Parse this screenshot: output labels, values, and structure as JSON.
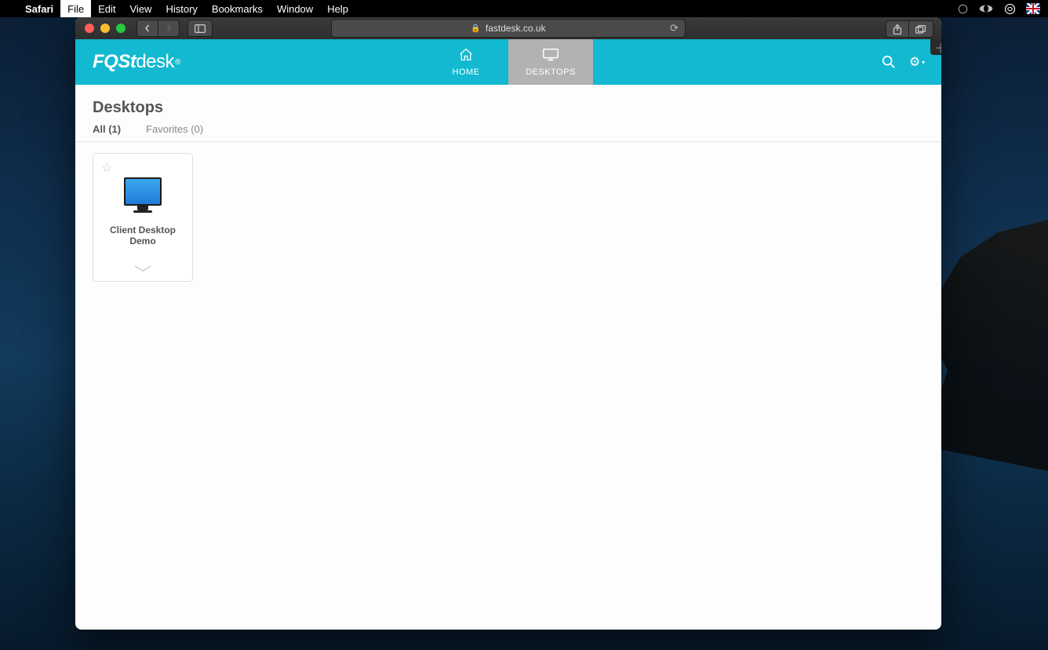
{
  "menubar": {
    "app_name": "Safari",
    "items": [
      "File",
      "Edit",
      "View",
      "History",
      "Bookmarks",
      "Window",
      "Help"
    ],
    "highlighted_index": 0
  },
  "browser": {
    "url_display": "fastdesk.co.uk",
    "lock_icon": "🔒"
  },
  "header": {
    "brand_bold": "FQSt",
    "brand_light": "desk",
    "nav": [
      {
        "label": "HOME",
        "icon": "home"
      },
      {
        "label": "DESKTOPS",
        "icon": "desktop"
      }
    ],
    "active_nav_index": 1
  },
  "page": {
    "title": "Desktops",
    "filters": [
      {
        "label": "All (1)",
        "active": true
      },
      {
        "label": "Favorites (0)",
        "active": false
      }
    ],
    "desktops": [
      {
        "name": "Client Desktop Demo"
      }
    ]
  }
}
